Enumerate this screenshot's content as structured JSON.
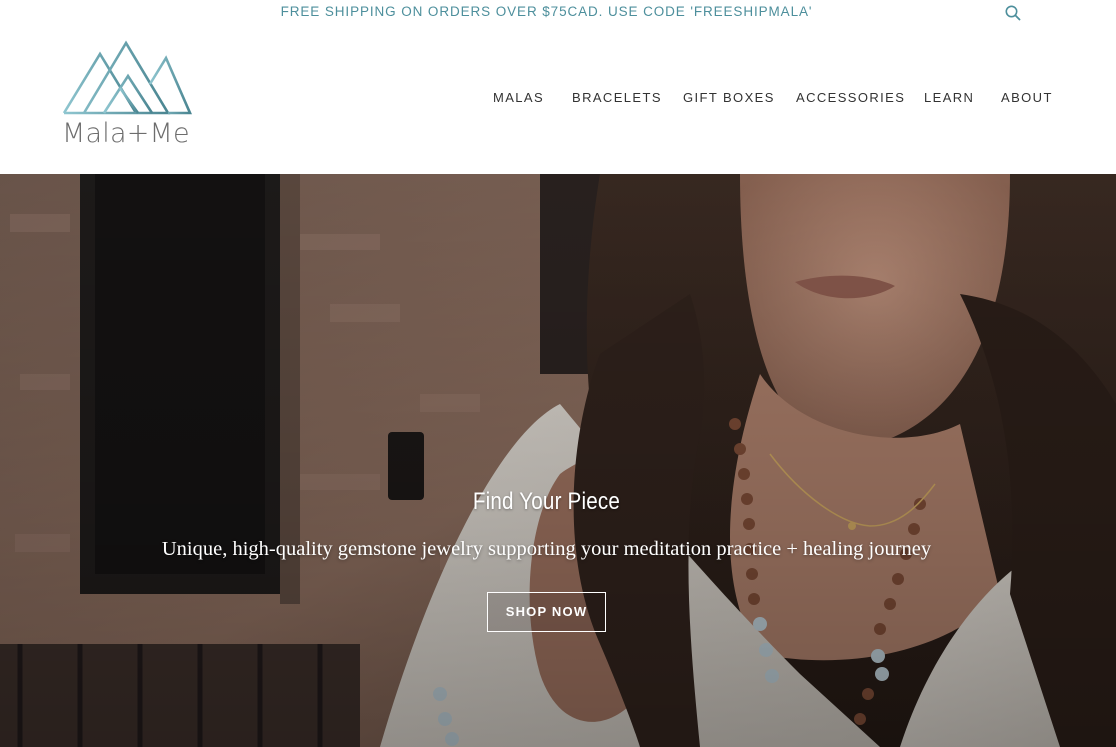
{
  "announcement": {
    "text": "FREE SHIPPING ON ORDERS OVER $75CAD. USE CODE 'FREESHIPMALA'",
    "color": "#4d8f9c"
  },
  "header": {
    "logo_text": "Mala+Me",
    "search_icon": "search-icon",
    "nav": [
      {
        "label": "MALAS"
      },
      {
        "label": "BRACELETS"
      },
      {
        "label": "GIFT BOXES"
      },
      {
        "label": "ACCESSORIES"
      },
      {
        "label": "LEARN"
      },
      {
        "label": "ABOUT"
      }
    ]
  },
  "hero": {
    "title": "Find Your Piece",
    "subtitle": "Unique, high-quality gemstone jewelry supporting your meditation practice + healing journey",
    "button_label": "SHOP NOW"
  },
  "colors": {
    "brand_teal": "#5a9aa6",
    "nav_text": "#333333"
  }
}
